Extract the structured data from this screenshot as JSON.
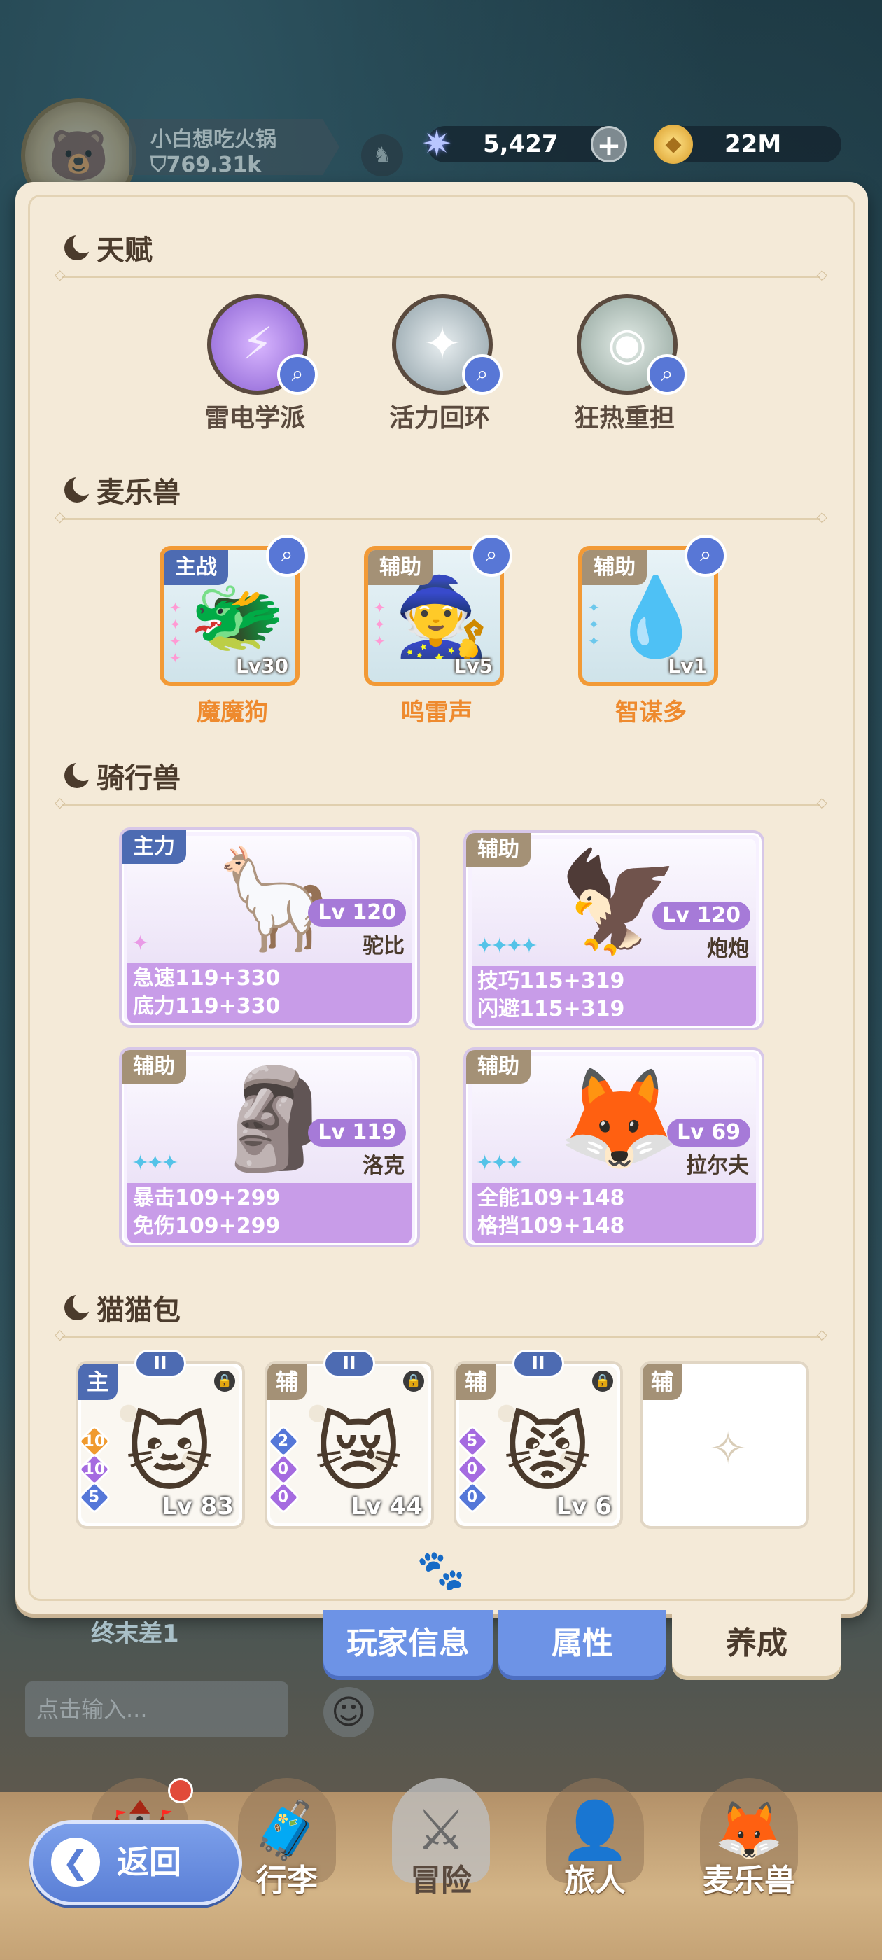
{
  "top_bar": {
    "player_name": "小白想吃火锅",
    "player_power": "769.31k",
    "gem_amount": "5,427",
    "gold_amount": "22M"
  },
  "sections": {
    "talent": "天赋",
    "beasts": "麦乐兽",
    "mounts": "骑行兽",
    "cat_bags": "猫猫包"
  },
  "talents": [
    {
      "name": "雷电学派",
      "icon": "lightning-talent-icon"
    },
    {
      "name": "活力回环",
      "icon": "star-burst-talent-icon"
    },
    {
      "name": "狂热重担",
      "icon": "eye-shield-talent-icon"
    }
  ],
  "beasts": [
    {
      "role": "主战",
      "name": "魔魔狗",
      "level": "Lv30"
    },
    {
      "role": "辅助",
      "name": "鸣雷声",
      "level": "Lv5"
    },
    {
      "role": "辅助",
      "name": "智谋多",
      "level": "Lv1"
    }
  ],
  "mounts": [
    {
      "role": "主力",
      "level": "Lv 120",
      "name": "驼比",
      "stat1": "急速119+330",
      "stat2": "底力119+330",
      "stars": 1
    },
    {
      "role": "辅助",
      "level": "Lv 120",
      "name": "炮炮",
      "stat1": "技巧115+319",
      "stat2": "闪避115+319",
      "stars": 4
    },
    {
      "role": "辅助",
      "level": "Lv 119",
      "name": "洛克",
      "stat1": "暴击109+299",
      "stat2": "免伤109+299",
      "stars": 3
    },
    {
      "role": "辅助",
      "level": "Lv 69",
      "name": "拉尔夫",
      "stat1": "全能109+148",
      "stat2": "格挡109+148",
      "stars": 3
    }
  ],
  "cat_bags": [
    {
      "role": "主",
      "grade": "II",
      "level": "Lv 83",
      "gems": [
        "10",
        "10",
        "5"
      ]
    },
    {
      "role": "辅",
      "grade": "II",
      "level": "Lv 44",
      "gems": [
        "2",
        "0",
        "0"
      ]
    },
    {
      "role": "辅",
      "grade": "II",
      "level": "Lv 6",
      "gems": [
        "5",
        "0",
        "0"
      ]
    },
    {
      "role": "辅"
    }
  ],
  "tabs": {
    "player_info": "玩家信息",
    "attributes": "属性",
    "cultivation": "养成"
  },
  "background": {
    "other_player_name": "终末差1",
    "chat_placeholder": "点击输入..."
  },
  "bottom_nav": {
    "luggage": "行李",
    "adventure": "冒险",
    "traveler": "旅人",
    "beasts": "麦乐兽"
  },
  "back_label": "返回"
}
